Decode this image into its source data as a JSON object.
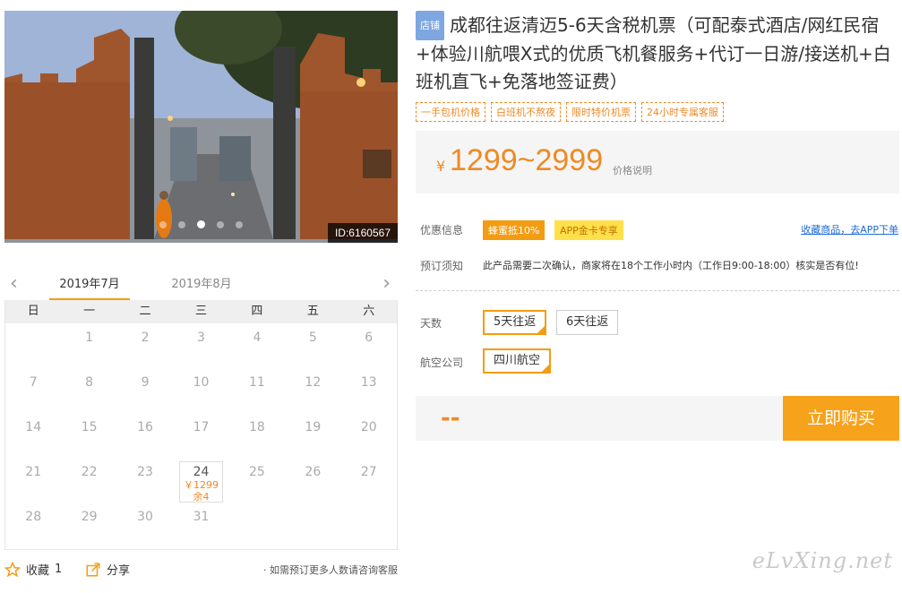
{
  "photo": {
    "id_label": "ID:6160567",
    "dots": 5,
    "active_dot": 2,
    "alt_icon": "city-gate-photo"
  },
  "calendar": {
    "prev_icon": "chevron-left-icon",
    "next_icon": "chevron-right-icon",
    "months": [
      "2019年7月",
      "2019年8月"
    ],
    "active_month": 0,
    "weekdays": [
      "日",
      "一",
      "二",
      "三",
      "四",
      "五",
      "六"
    ],
    "weeks": [
      [
        "",
        "1",
        "2",
        "3",
        "4",
        "5",
        "6"
      ],
      [
        "7",
        "8",
        "9",
        "10",
        "11",
        "12",
        "13"
      ],
      [
        "14",
        "15",
        "16",
        "17",
        "18",
        "19",
        "20"
      ],
      [
        "21",
        "22",
        "23",
        "24",
        "25",
        "26",
        "27"
      ],
      [
        "28",
        "29",
        "30",
        "31",
        "",
        "",
        ""
      ]
    ],
    "available": {
      "day": "24",
      "price": "￥1299",
      "stock": "余4"
    }
  },
  "bottom": {
    "fav_label": "收藏",
    "fav_count": "1",
    "share_label": "分享",
    "note": "· 如需预订更多人数请咨询客服"
  },
  "product": {
    "store_badge": "店铺",
    "title": "成都往返清迈5-6天含税机票（可配泰式酒店/网红民宿+体验川航喂X式的优质飞机餐服务+代订一日游/接送机+白班机直飞+免落地签证费）",
    "tags": [
      "一手包机价格",
      "白班机不熬夜",
      "限时特价机票",
      "24小时专属客服"
    ],
    "currency": "¥",
    "price_range": "1299~2999",
    "price_explain": "价格说明"
  },
  "info": {
    "promo_label": "优惠信息",
    "promo_1": "蜂蜜抵10%",
    "promo_2": "APP金卡专享",
    "fav_app_link": "收藏商品，去APP下单",
    "notice_label": "预订须知",
    "notice_text": "此产品需要二次确认，商家将在18个工作小时内（工作日9:00-18:00）核实是否有位!"
  },
  "options": {
    "days_label": "天数",
    "days": [
      "5天往返",
      "6天往返"
    ],
    "days_selected": 0,
    "airline_label": "航空公司",
    "airlines": [
      "四川航空"
    ],
    "airline_selected": 0
  },
  "purchase": {
    "total": "--",
    "buy_label": "立即购买"
  },
  "watermark": "eLvXing.net",
  "colors": {
    "accent": "#f39c12",
    "price": "#f08a24",
    "link": "#1e6bd6",
    "badge": "#7ea6e0"
  }
}
